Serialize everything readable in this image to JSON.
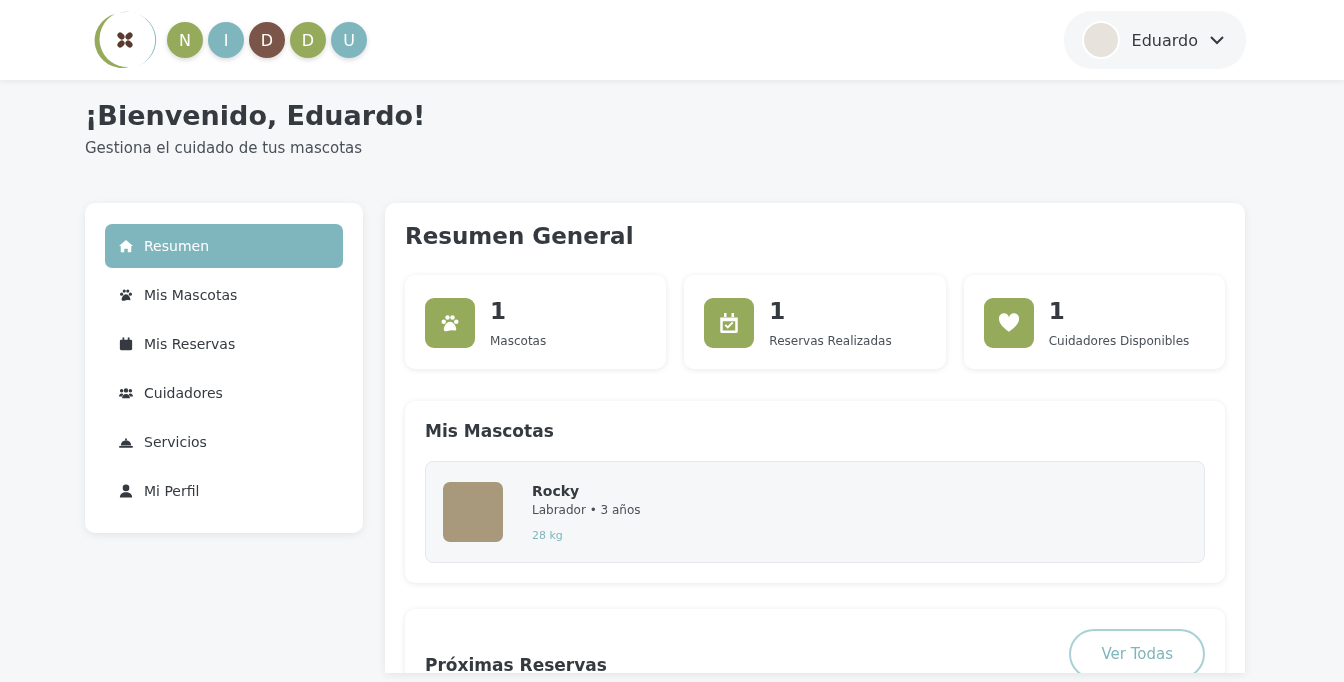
{
  "logo": {
    "letters": [
      {
        "text": "N",
        "color": "#96aa5b"
      },
      {
        "text": "I",
        "color": "#7fb6bd"
      },
      {
        "text": "D",
        "color": "#7b5648"
      },
      {
        "text": "D",
        "color": "#96aa5b"
      },
      {
        "text": "U",
        "color": "#7fb6bd"
      }
    ]
  },
  "user_menu": {
    "name": "Eduardo"
  },
  "welcome": {
    "title": "¡Bienvenido, Eduardo!",
    "subtitle": "Gestiona el cuidado de tus mascotas"
  },
  "sidebar": {
    "items": [
      {
        "label": "Resumen",
        "kind": "home",
        "selected": true
      },
      {
        "label": "Mis Mascotas",
        "kind": "paw",
        "selected": false
      },
      {
        "label": "Mis Reservas",
        "kind": "calendar",
        "selected": false
      },
      {
        "label": "Cuidadores",
        "kind": "users",
        "selected": false
      },
      {
        "label": "Servicios",
        "kind": "bell",
        "selected": false
      },
      {
        "label": "Mi Perfil",
        "kind": "user",
        "selected": false
      }
    ]
  },
  "summary": {
    "title": "Resumen General",
    "stats": [
      {
        "value": "1",
        "label": "Mascotas",
        "kind": "paw"
      },
      {
        "value": "1",
        "label": "Reservas Realizadas",
        "kind": "calendar-check"
      },
      {
        "value": "1",
        "label": "Cuidadores Disponibles",
        "kind": "heart"
      }
    ]
  },
  "pets": {
    "title": "Mis Mascotas",
    "items": [
      {
        "name": "Rocky",
        "details": "Labrador • 3 años",
        "weight": "28 kg"
      }
    ]
  },
  "bookings": {
    "title": "Próximas Reservas",
    "button": "Ver Todas"
  }
}
